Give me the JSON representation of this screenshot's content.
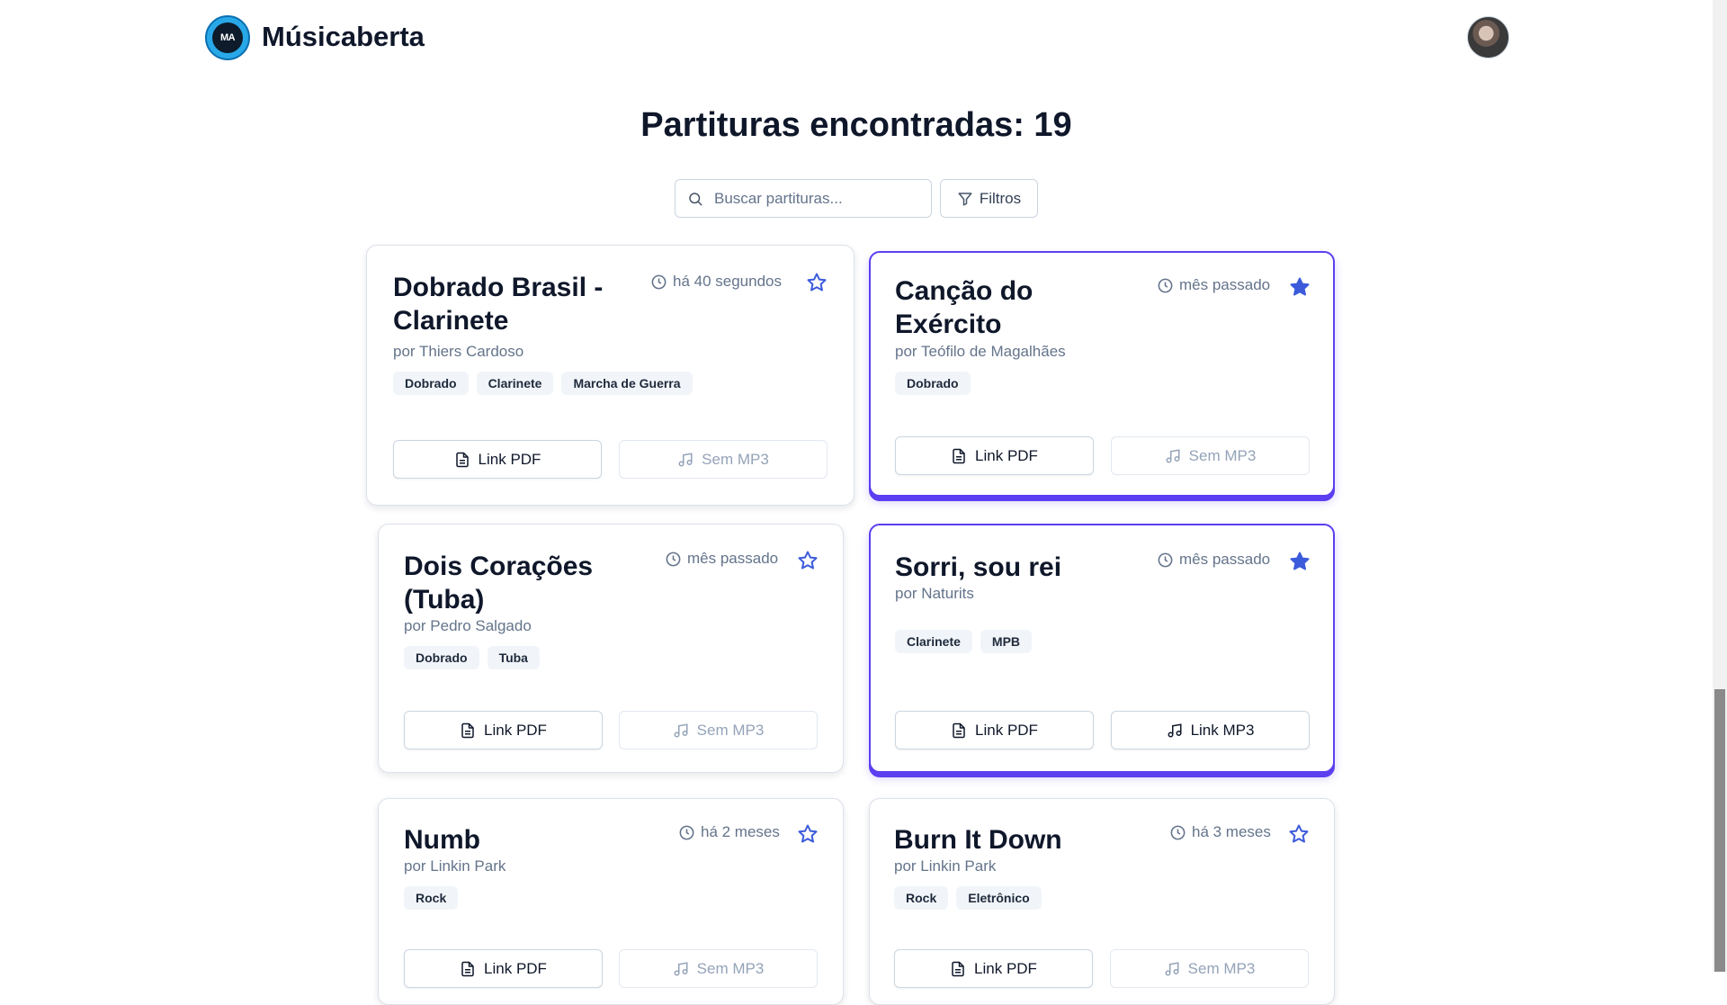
{
  "app": {
    "title": "Músicaberta",
    "logo_text": "MA"
  },
  "page": {
    "heading": "Partituras encontradas: 19"
  },
  "search": {
    "placeholder": "Buscar partituras...",
    "value": ""
  },
  "filters": {
    "label": "Filtros"
  },
  "cards": [
    {
      "title": "Dobrado Brasil - Clarinete",
      "time": "há 40 segundos",
      "author": "por Thiers Cardoso",
      "favorite": false,
      "tags": [
        "Dobrado",
        "Clarinete",
        "Marcha de Guerra"
      ],
      "pdf_label": "Link PDF",
      "mp3_label": "Sem MP3",
      "mp3_available": false
    },
    {
      "title": "Canção do Exército",
      "time": "mês passado",
      "author": "por Teófilo de Magalhães",
      "favorite": true,
      "tags": [
        "Dobrado"
      ],
      "pdf_label": "Link PDF",
      "mp3_label": "Sem MP3",
      "mp3_available": false
    },
    {
      "title": "Dois Corações (Tuba)",
      "time": "mês passado",
      "author": "por Pedro Salgado",
      "favorite": false,
      "tags": [
        "Dobrado",
        "Tuba"
      ],
      "pdf_label": "Link PDF",
      "mp3_label": "Sem MP3",
      "mp3_available": false
    },
    {
      "title": "Sorri, sou rei",
      "time": "mês passado",
      "author": "por Naturits",
      "favorite": true,
      "tags": [
        "Clarinete",
        "MPB"
      ],
      "pdf_label": "Link PDF",
      "mp3_label": "Link MP3",
      "mp3_available": true
    },
    {
      "title": "Numb",
      "time": "há 2 meses",
      "author": "por Linkin Park",
      "favorite": false,
      "tags": [
        "Rock"
      ],
      "pdf_label": "Link PDF",
      "mp3_label": "Sem MP3",
      "mp3_available": false
    },
    {
      "title": "Burn It Down",
      "time": "há 3 meses",
      "author": "por Linkin Park",
      "favorite": false,
      "tags": [
        "Rock",
        "Eletrônico"
      ],
      "pdf_label": "Link PDF",
      "mp3_label": "Sem MP3",
      "mp3_available": false
    }
  ],
  "colors": {
    "accent": "#5b3ff0",
    "star": "#3b5bdb",
    "text": "#0f172a",
    "muted": "#64748b"
  },
  "icons": {
    "search": "search-icon",
    "filter": "filter-icon",
    "clock": "clock-icon",
    "star": "star-icon",
    "pdf": "file-text-icon",
    "mp3": "music-note-icon"
  }
}
